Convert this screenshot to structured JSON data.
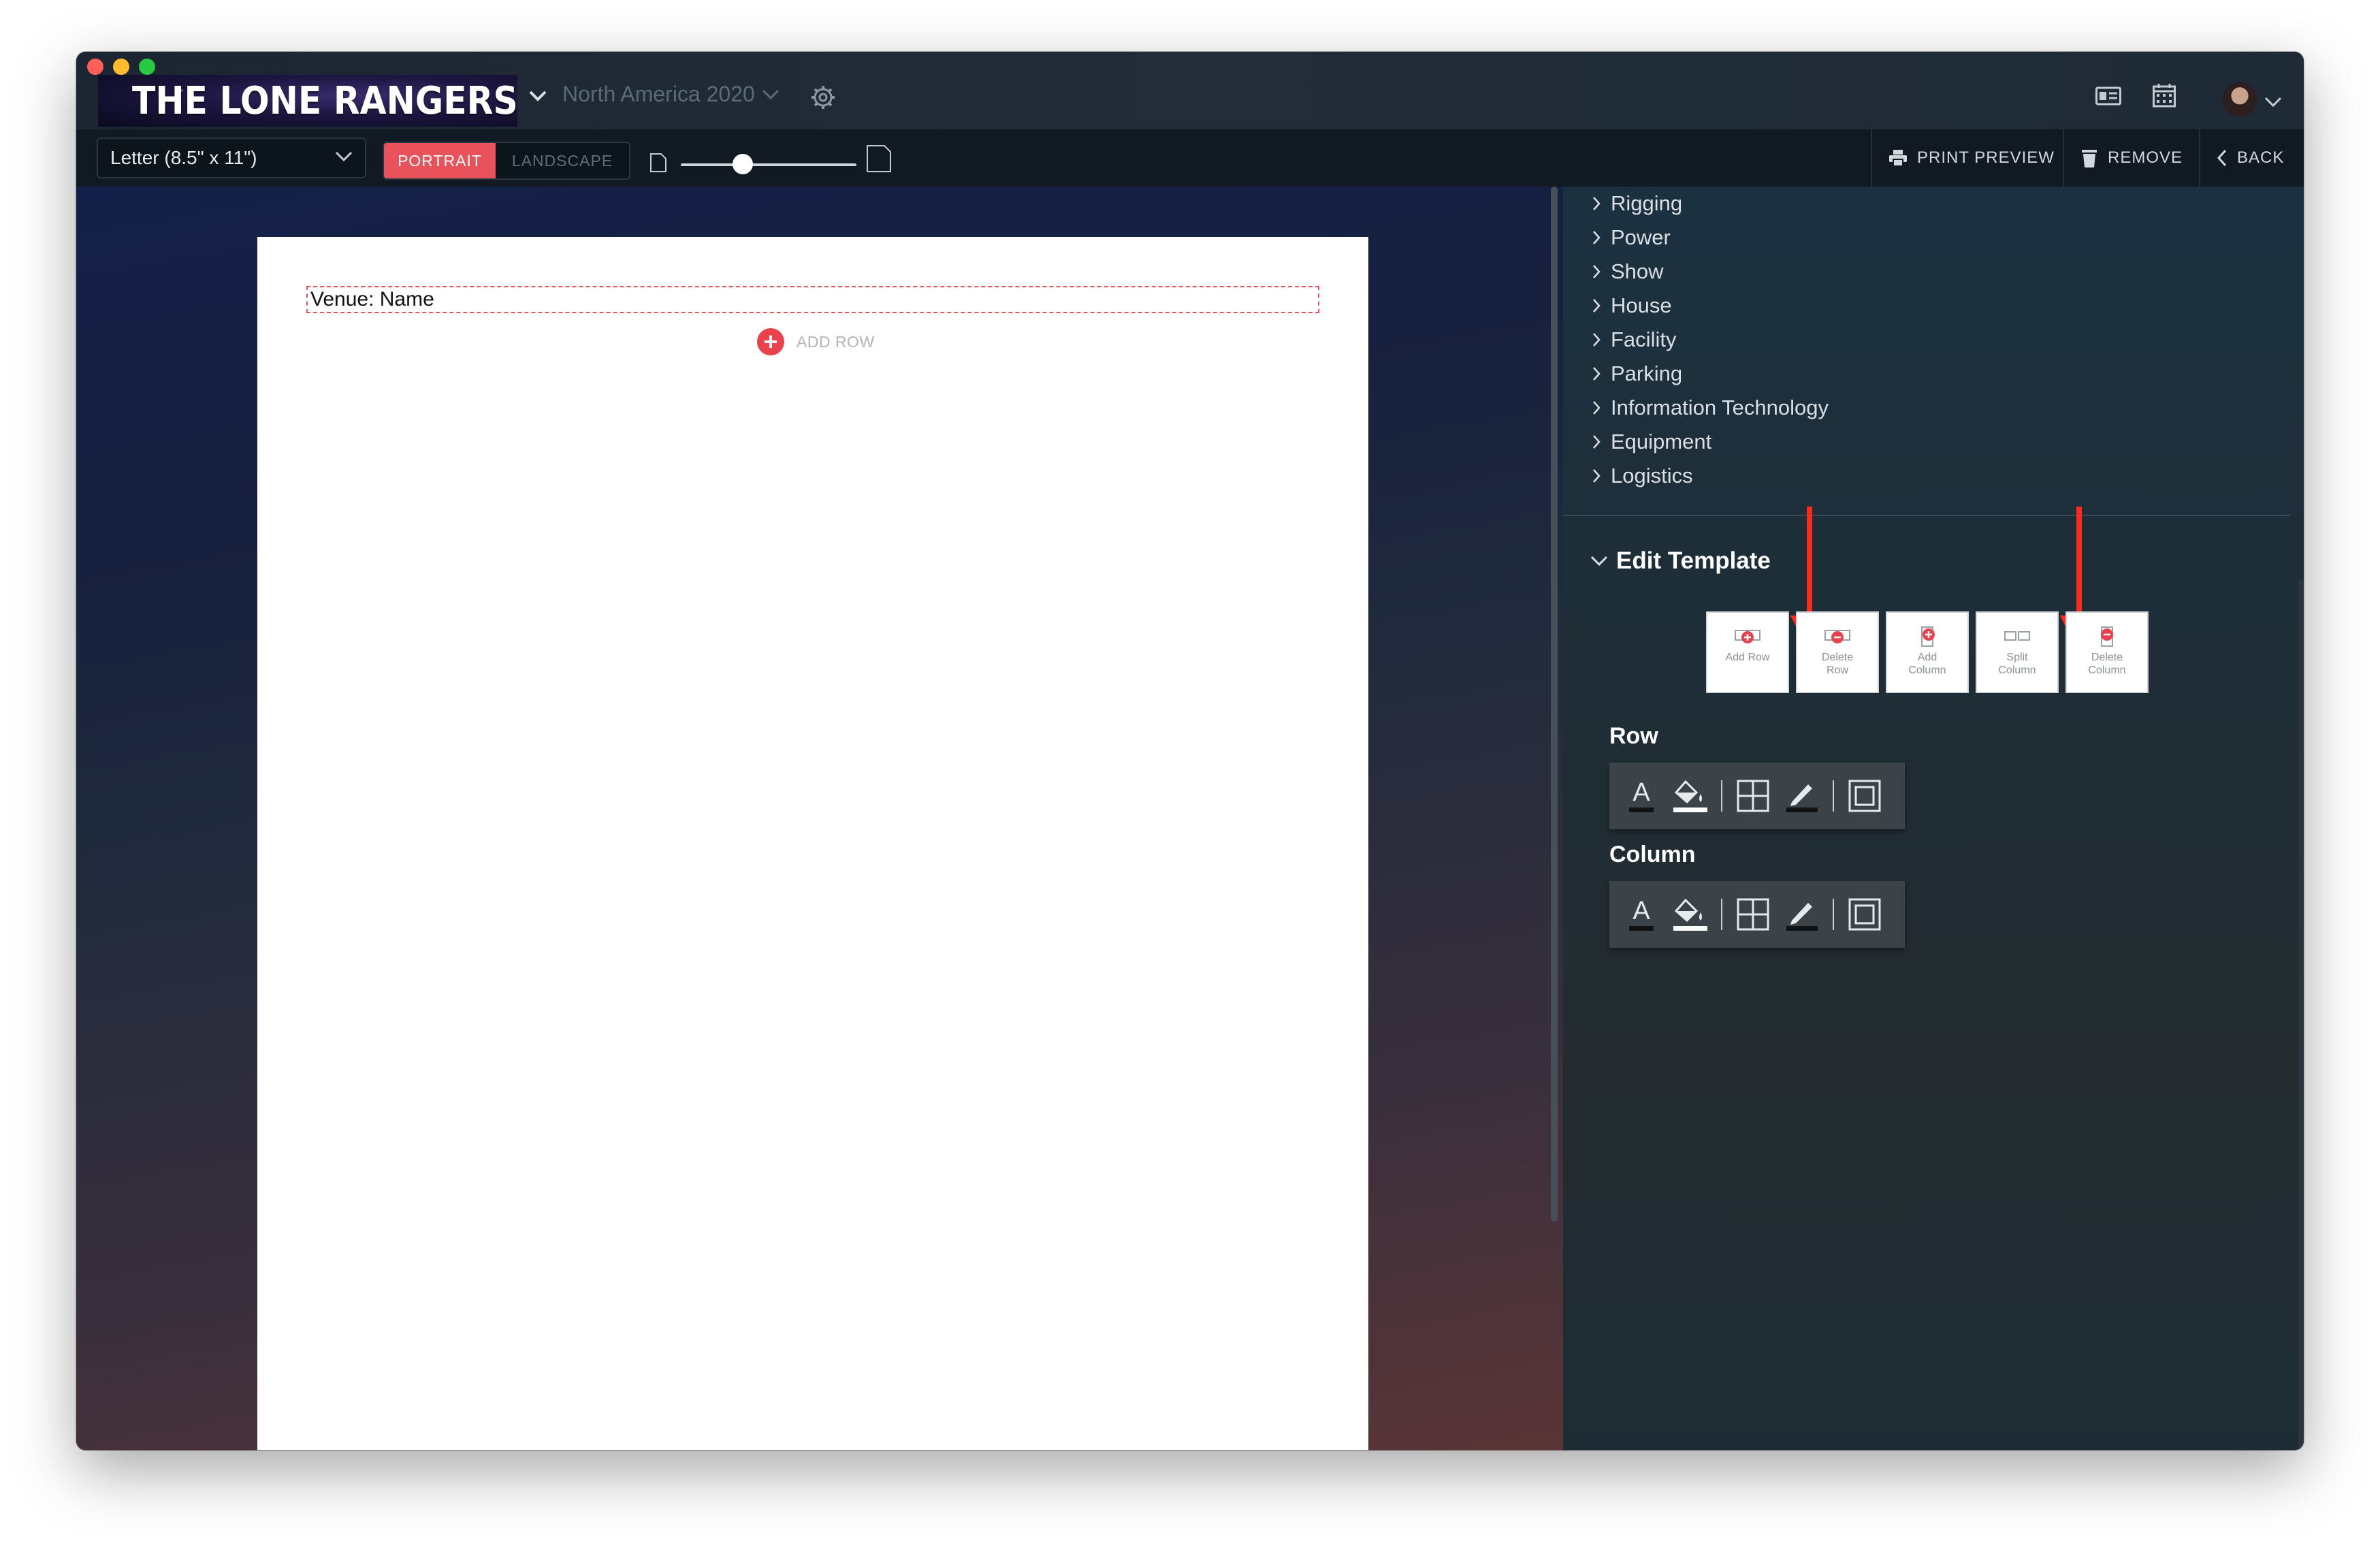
{
  "header": {
    "brand": "THE LONE RANGERS",
    "project": "North America 2020"
  },
  "toolbar": {
    "paper_size": "Letter (8.5\" x 11\")",
    "orientation": {
      "portrait": "PORTRAIT",
      "landscape": "LANDSCAPE",
      "selected": "PORTRAIT"
    },
    "zoom_level": 0.3,
    "print_preview": "PRINT PREVIEW",
    "remove": "REMOVE",
    "back": "BACK"
  },
  "page": {
    "venue_field": "Venue: Name",
    "add_row": "ADD ROW"
  },
  "sidebar": {
    "categories": [
      "Rigging",
      "Power",
      "Show",
      "House",
      "Facility",
      "Parking",
      "Information Technology",
      "Equipment",
      "Logistics"
    ],
    "edit_template": {
      "title": "Edit Template",
      "buttons": [
        {
          "line1": "Add Row",
          "line2": ""
        },
        {
          "line1": "Delete",
          "line2": "Row"
        },
        {
          "line1": "Add",
          "line2": "Column"
        },
        {
          "line1": "Split",
          "line2": "Column"
        },
        {
          "line1": "Delete",
          "line2": "Column"
        }
      ]
    },
    "row_label": "Row",
    "column_label": "Column",
    "format_icons": [
      "text-color-icon",
      "fill-color-icon",
      "borders-icon",
      "border-color-icon",
      "padding-icon"
    ]
  },
  "colors": {
    "accent": "#e9525a",
    "annotation_arrow": "#ff2a1a"
  }
}
